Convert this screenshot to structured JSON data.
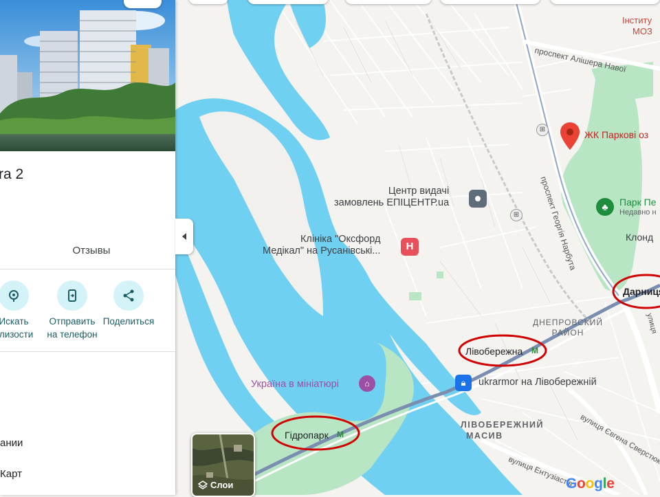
{
  "panel": {
    "title_fragment": "ra 2",
    "tab_reviews": "Отзывы",
    "actions": [
      {
        "label_line1": "Искать",
        "label_line2": "близости",
        "icon": "nearby-icon"
      },
      {
        "label_line1": "Отправить",
        "label_line2": "на телефон",
        "icon": "send-to-phone-icon"
      },
      {
        "label_line1": "Поделиться",
        "label_line2": "",
        "icon": "share-icon"
      }
    ],
    "list_items": [
      "ании",
      "Карт"
    ]
  },
  "map": {
    "labels": {
      "institute": "Інститу",
      "institute2": "МОЗ",
      "alishera": "проспект Алішера Навої",
      "pin_place": "ЖК Паркові оз",
      "park_name": "Парк Пе",
      "park_note": "Недавно н",
      "klond": "Клонд",
      "epicentr1": "Центр видачі",
      "epicentr2": "замовлень ЕПІЦЕНТР.ua",
      "clinic1": "Клініка \"Оксфорд",
      "clinic2": "Медікал\" на Русанівські...",
      "hospital_mark": "H",
      "narbuta": "проспект Георгія Нарбута",
      "darnytsia": "Дарниця",
      "dniprovskyi1": "ДНЕПРОВСКИЙ",
      "dniprovskyi2": "РАЙОН",
      "livoberezhna": "Лівобережна",
      "metro_mark": "M",
      "ukrainia_mini": "Україна в мініатюрі",
      "ukrarmor": "ukrarmor на Лівобережній",
      "livoberezhnyi1": "ЛІВОБЕРЕЖНИЙ",
      "livoberezhnyi2": "МАСИВ",
      "hidropark": "Гідропарк",
      "serhova": "вулиця Євгена Сверстюка",
      "entuziastiv": "вулиця Ентузіастів",
      "kyivska": "улиця"
    },
    "layers_label": "Слои",
    "brand": "Google",
    "colors": {
      "water": "#6fd0f2",
      "park": "#b8e5c3",
      "road": "#ffffff",
      "metro": "#5a7fb6",
      "pin": "#ea4335",
      "annotation": "#d00000",
      "poi_teal": "#1a8a7e",
      "poi_purple": "#9c4fa3"
    }
  }
}
